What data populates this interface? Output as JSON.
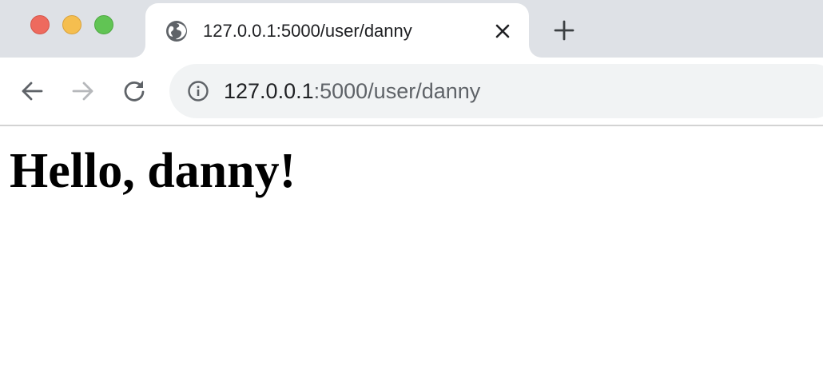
{
  "tab": {
    "title": "127.0.0.1:5000/user/danny",
    "favicon": "globe-icon"
  },
  "toolbar": {
    "back_icon": "arrow-left-icon",
    "forward_icon": "arrow-right-icon",
    "reload_icon": "reload-icon",
    "new_tab_icon": "plus-icon",
    "close_tab_icon": "close-icon"
  },
  "omnibox": {
    "host": "127.0.0.1",
    "rest": ":5000/user/danny",
    "info_icon": "info-icon"
  },
  "page": {
    "heading": "Hello, danny!"
  },
  "colors": {
    "tab_strip": "#dee1e6",
    "omnibox_bg": "#f1f3f4",
    "traffic_close": "#ee6a5e",
    "traffic_minimize": "#f5be4f",
    "traffic_maximize": "#61c454"
  }
}
